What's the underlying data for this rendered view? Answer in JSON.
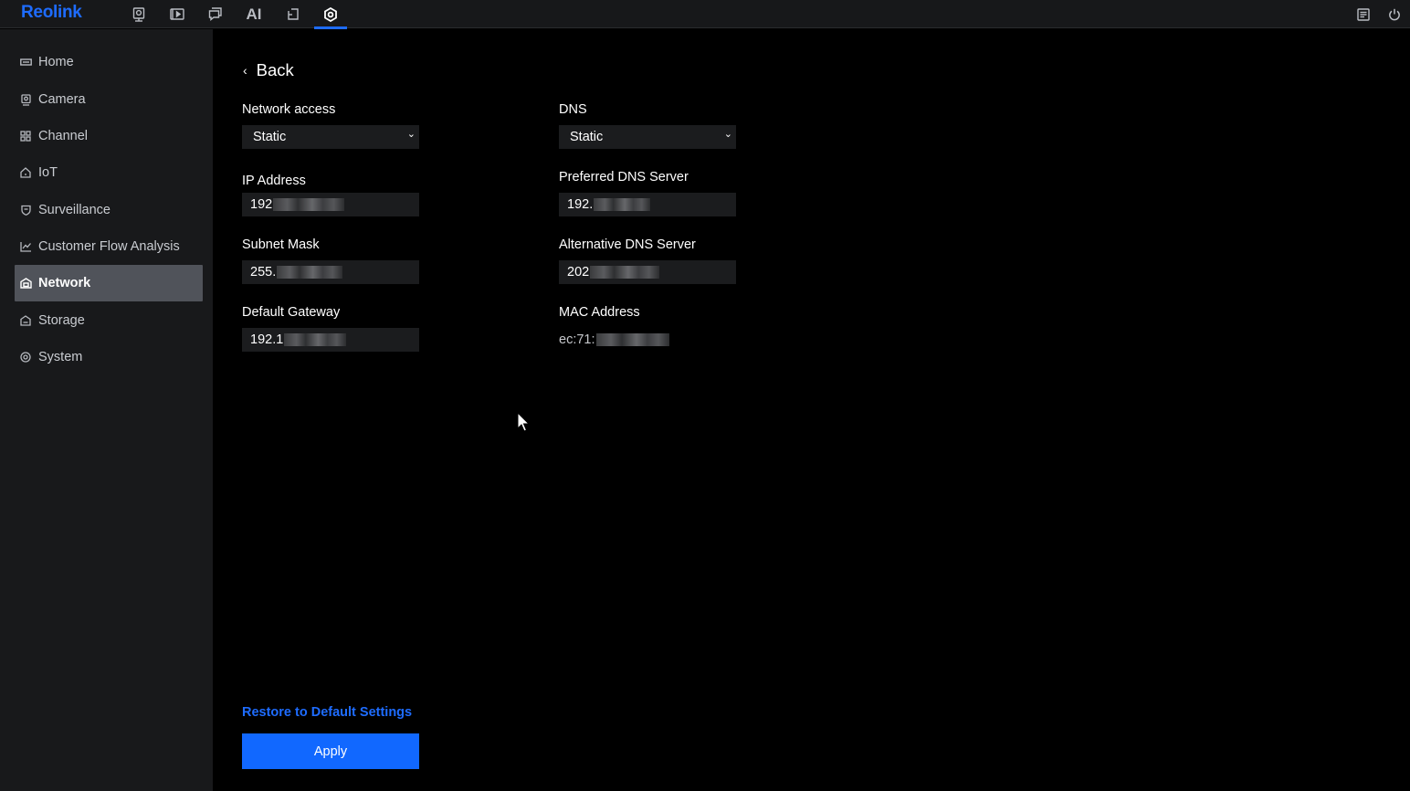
{
  "app": {
    "logo": "Reolink",
    "ai_tab_label": "AI"
  },
  "sidebar": {
    "items": [
      {
        "label": "Home",
        "icon": "home-icon"
      },
      {
        "label": "Camera",
        "icon": "camera-icon"
      },
      {
        "label": "Channel",
        "icon": "channel-grid-icon"
      },
      {
        "label": "IoT",
        "icon": "iot-house-icon"
      },
      {
        "label": "Surveillance",
        "icon": "shield-icon"
      },
      {
        "label": "Customer Flow Analysis",
        "icon": "chart-icon"
      },
      {
        "label": "Network",
        "icon": "network-icon",
        "active": true
      },
      {
        "label": "Storage",
        "icon": "storage-icon"
      },
      {
        "label": "System",
        "icon": "system-icon"
      }
    ]
  },
  "main": {
    "back_label": "Back",
    "network_access": {
      "label": "Network access",
      "value": "Static"
    },
    "ip_address": {
      "label": "IP Address",
      "value_visible": "192"
    },
    "subnet_mask": {
      "label": "Subnet Mask",
      "value_visible": "255."
    },
    "default_gateway": {
      "label": "Default Gateway",
      "value_visible": "192.1"
    },
    "dns": {
      "label": "DNS",
      "value": "Static"
    },
    "preferred_dns": {
      "label": "Preferred DNS Server",
      "value_visible": "192."
    },
    "alternative_dns": {
      "label": "Alternative DNS Server",
      "value_visible": "202"
    },
    "mac_address": {
      "label": "MAC Address",
      "value_visible": "ec:71:"
    },
    "restore_label": "Restore to Default Settings",
    "apply_label": "Apply"
  },
  "colors": {
    "accent": "#1E6CFF",
    "apply_button": "#1168FF",
    "sidebar_active": "#50535A"
  }
}
